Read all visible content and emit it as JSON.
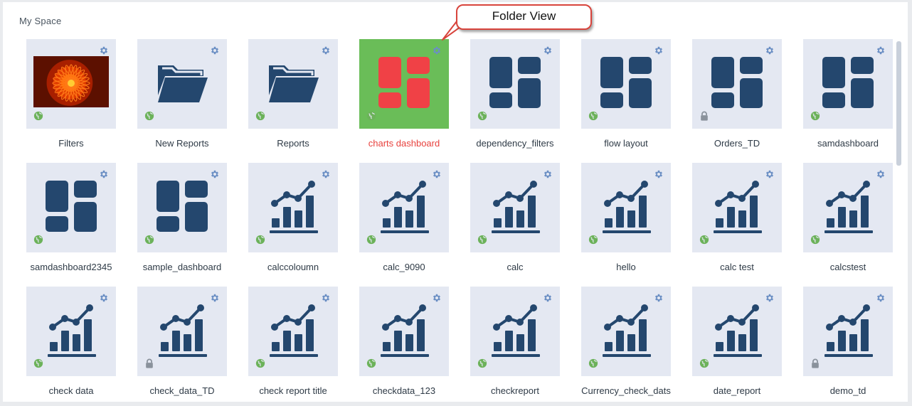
{
  "space_title": "My Space",
  "callout_text": "Folder View",
  "colors": {
    "icon_dark": "#24476e",
    "selected_bg": "#6abd58",
    "selected_icon": "#f04146",
    "selected_label": "#e8413d",
    "gear": "#6b8fc4",
    "globe": "#6cb25a",
    "lock": "#8a929c"
  },
  "items": [
    {
      "label": "Filters",
      "icon": "photo-icon",
      "status": "globe-icon",
      "selected": false
    },
    {
      "label": "New Reports",
      "icon": "folder-icon",
      "status": "globe-icon",
      "selected": false
    },
    {
      "label": "Reports",
      "icon": "folder-icon",
      "status": "globe-icon",
      "selected": false
    },
    {
      "label": "charts dashboard",
      "icon": "dashboard-icon",
      "status": "globe-icon",
      "selected": true
    },
    {
      "label": "dependency_filters",
      "icon": "dashboard-icon",
      "status": "globe-icon",
      "selected": false
    },
    {
      "label": "flow layout",
      "icon": "dashboard-icon",
      "status": "globe-icon",
      "selected": false
    },
    {
      "label": "Orders_TD",
      "icon": "dashboard-icon",
      "status": "lock-icon",
      "selected": false
    },
    {
      "label": "samdashboard",
      "icon": "dashboard-icon",
      "status": "globe-icon",
      "selected": false
    },
    {
      "label": "samdashboard2345",
      "icon": "dashboard-icon",
      "status": "globe-icon",
      "selected": false
    },
    {
      "label": "sample_dashboard",
      "icon": "dashboard-icon",
      "status": "globe-icon",
      "selected": false
    },
    {
      "label": "calccoloumn",
      "icon": "report-chart-icon",
      "status": "globe-icon",
      "selected": false
    },
    {
      "label": "calc_9090",
      "icon": "report-chart-icon",
      "status": "globe-icon",
      "selected": false
    },
    {
      "label": "calc",
      "icon": "report-chart-icon",
      "status": "globe-icon",
      "selected": false
    },
    {
      "label": "hello",
      "icon": "report-chart-icon",
      "status": "globe-icon",
      "selected": false
    },
    {
      "label": "calc test",
      "icon": "report-chart-icon",
      "status": "globe-icon",
      "selected": false
    },
    {
      "label": "calcstest",
      "icon": "report-chart-icon",
      "status": "globe-icon",
      "selected": false
    },
    {
      "label": "check data",
      "icon": "report-chart-icon",
      "status": "globe-icon",
      "selected": false
    },
    {
      "label": "check_data_TD",
      "icon": "report-chart-icon",
      "status": "lock-icon",
      "selected": false
    },
    {
      "label": "check report title",
      "icon": "report-chart-icon",
      "status": "globe-icon",
      "selected": false
    },
    {
      "label": "checkdata_123",
      "icon": "report-chart-icon",
      "status": "globe-icon",
      "selected": false
    },
    {
      "label": "checkreport",
      "icon": "report-chart-icon",
      "status": "globe-icon",
      "selected": false
    },
    {
      "label": "Currency_check_dats",
      "icon": "report-chart-icon",
      "status": "globe-icon",
      "selected": false
    },
    {
      "label": "date_report",
      "icon": "report-chart-icon",
      "status": "globe-icon",
      "selected": false
    },
    {
      "label": "demo_td",
      "icon": "report-chart-icon",
      "status": "lock-icon",
      "selected": false
    }
  ]
}
